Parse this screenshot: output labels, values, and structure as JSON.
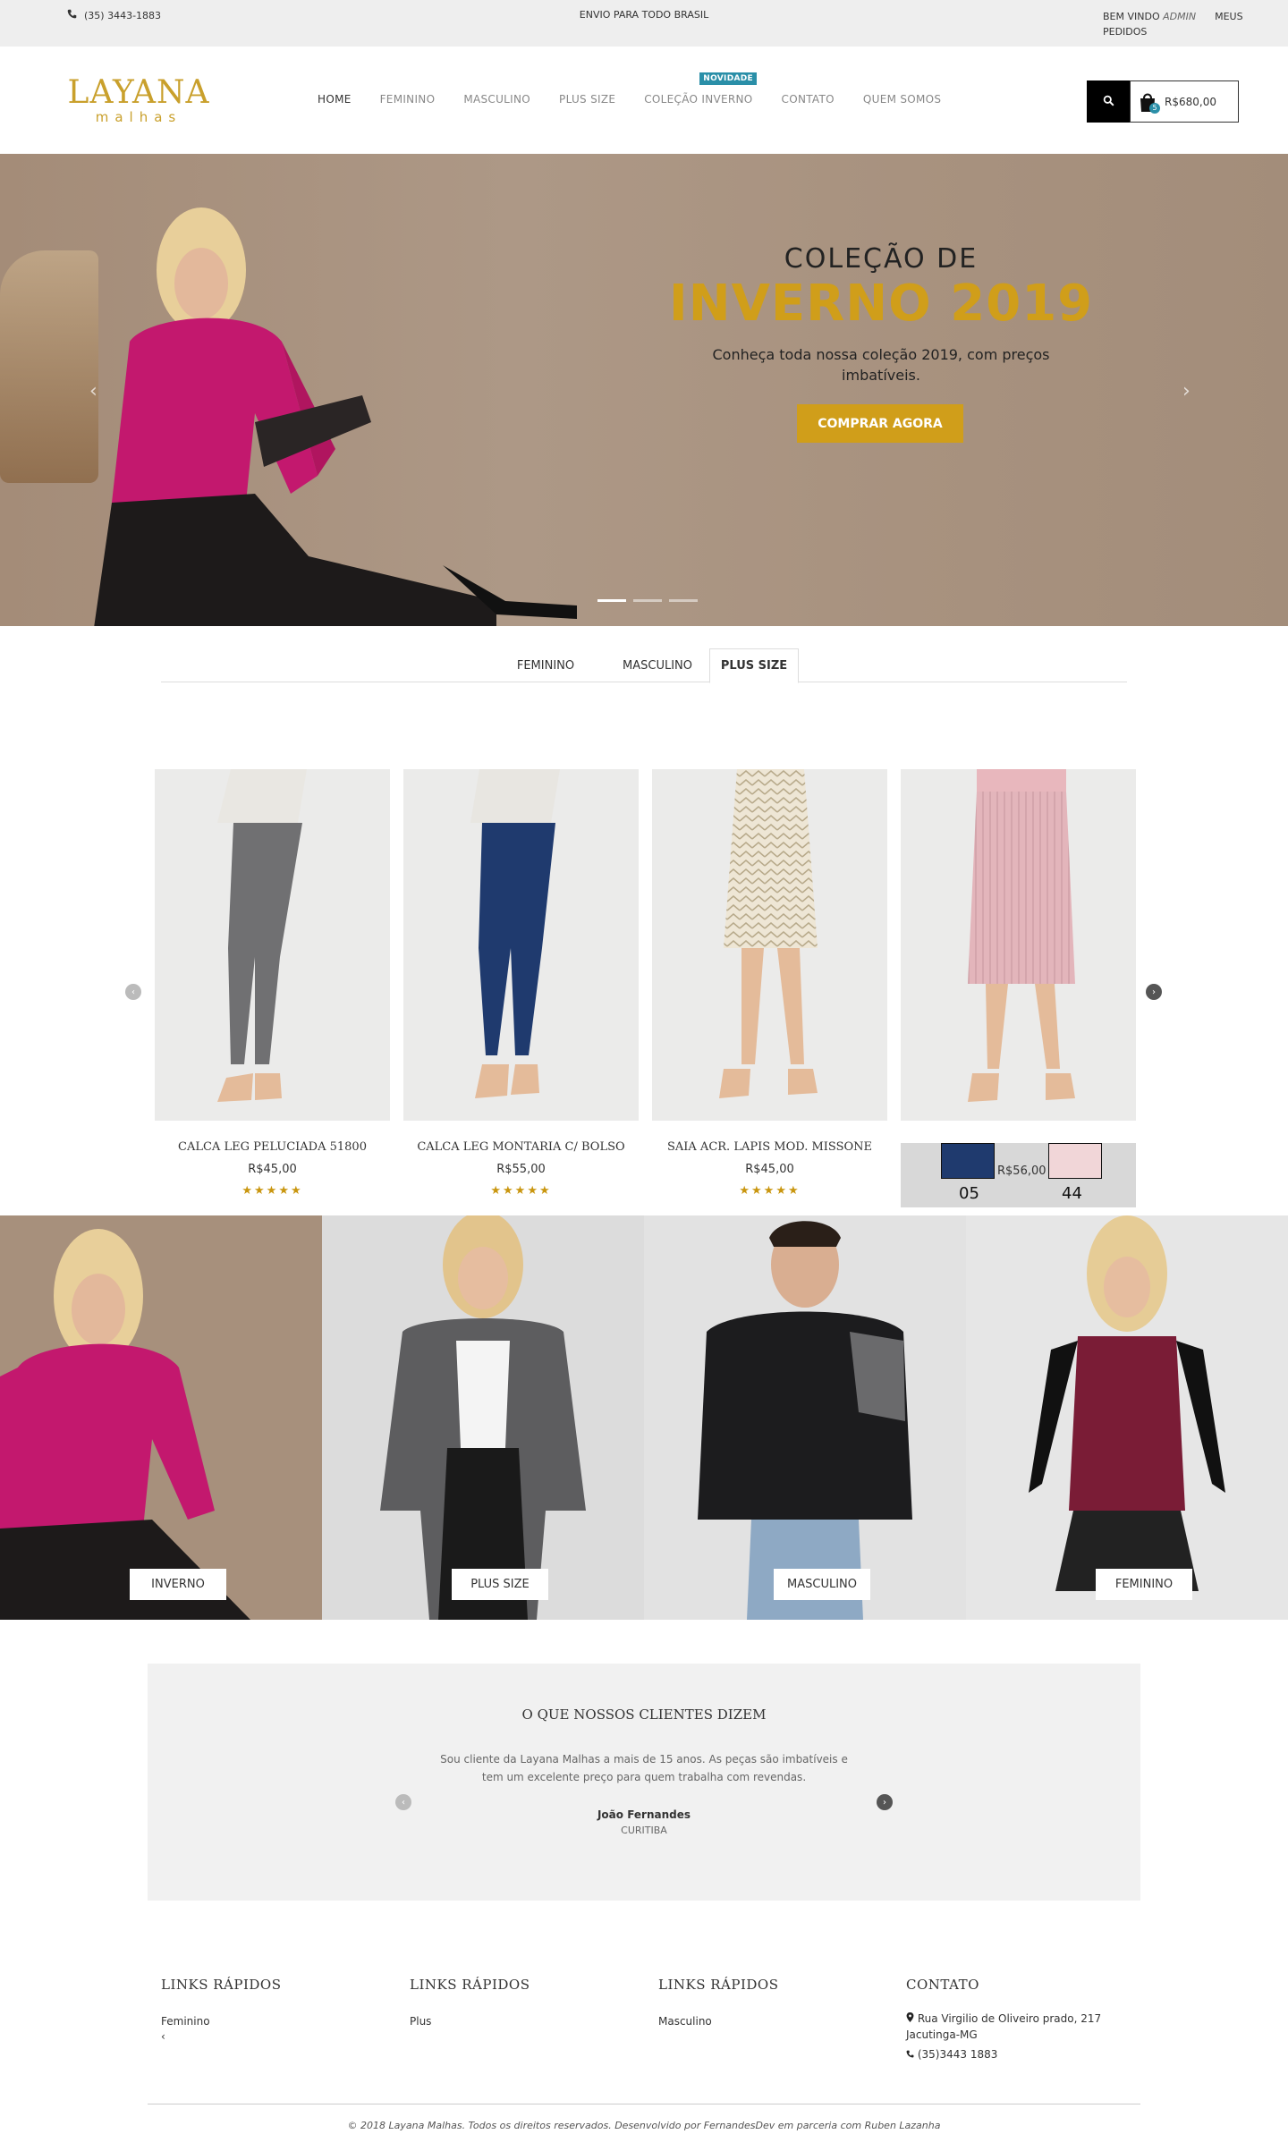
{
  "topbar": {
    "phone": "(35) 3443-1883",
    "shipping": "ENVIO PARA TODO BRASIL",
    "welcome_prefix": "BEM VINDO",
    "welcome_user": "ADMIN",
    "my_orders": "MEUS PEDIDOS"
  },
  "logo": {
    "line1": "LAYANA",
    "line2": "malhas"
  },
  "nav": {
    "items": [
      "HOME",
      "FEMININO",
      "MASCULINO",
      "PLUS SIZE",
      "COLEÇÃO INVERNO",
      "CONTATO",
      "QUEM SOMOS"
    ],
    "badge": "NOVIDADE"
  },
  "cart": {
    "total": "R$680,00",
    "count": "5"
  },
  "hero": {
    "subtitle": "COLEÇÃO DE",
    "title": "INVERNO 2019",
    "description": "Conheça toda nossa coleção 2019, com preços imbatíveis.",
    "button": "COMPRAR AGORA"
  },
  "tabs": [
    "FEMININO",
    "MASCULINO",
    "PLUS SIZE"
  ],
  "products": [
    {
      "name": "CALCA LEG PELUCIADA      51800",
      "price": "R$45,00",
      "rating": 5
    },
    {
      "name": "CALCA LEG MONTARIA C/ BOLSO",
      "price": "R$55,00",
      "rating": 5
    },
    {
      "name": "SAIA ACR. LAPIS MOD. MISSONE",
      "price": "R$45,00",
      "rating": 5
    },
    {
      "name": "",
      "price": "R$56,00",
      "swatch_left": "05",
      "swatch_right": "44"
    }
  ],
  "categories": [
    "INVERNO",
    "PLUS SIZE",
    "MASCULINO",
    "FEMININO"
  ],
  "testimonial": {
    "title": "O QUE NOSSOS CLIENTES DIZEM",
    "text": "Sou cliente da Layana Malhas a mais de 15 anos. As peças são imbatíveis e tem um excelente preço para quem trabalha com revendas.",
    "name": "João Fernandes",
    "city": "CURITIBA"
  },
  "footer": {
    "col1": {
      "heading": "LINKS RÁPIDOS",
      "link": "Feminino",
      "extra": "‹"
    },
    "col2": {
      "heading": "LINKS RÁPIDOS",
      "link": "Plus"
    },
    "col3": {
      "heading": "LINKS RÁPIDOS",
      "link": "Masculino"
    },
    "contact": {
      "heading": "CONTATO",
      "address": "Rua Virgilio de Oliveiro prado, 217 Jacutinga-MG",
      "phone": "(35)3443 1883"
    },
    "copyright": "© 2018 Layana Malhas. Todos os direitos reservados. Desenvolvido por FernandesDev em parceria com Ruben Lazanha"
  },
  "colors": {
    "accent": "#d09e1a",
    "badge": "#2a8fa8",
    "topbar": "#eeeeee"
  }
}
